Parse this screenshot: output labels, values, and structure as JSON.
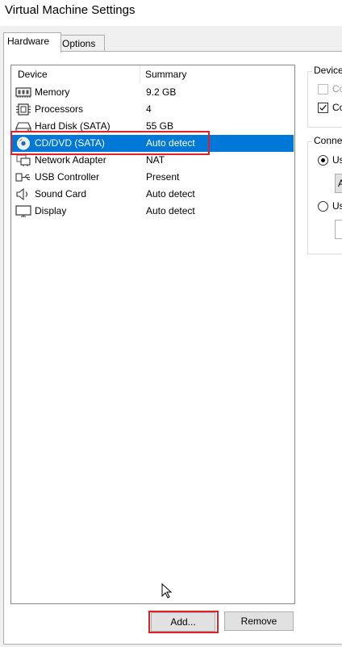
{
  "window": {
    "title": "Virtual Machine Settings"
  },
  "tabs": [
    {
      "label": "Hardware",
      "active": true
    },
    {
      "label": "Options",
      "active": false
    }
  ],
  "device_list": {
    "columns": [
      "Device",
      "Summary"
    ],
    "rows": [
      {
        "icon": "memory-icon",
        "device": "Memory",
        "summary": "9.2 GB"
      },
      {
        "icon": "processor-icon",
        "device": "Processors",
        "summary": "4"
      },
      {
        "icon": "hard-disk-icon",
        "device": "Hard Disk (SATA)",
        "summary": "55 GB"
      },
      {
        "icon": "cd-dvd-icon",
        "device": "CD/DVD (SATA)",
        "summary": "Auto detect",
        "selected": true
      },
      {
        "icon": "network-adapter-icon",
        "device": "Network Adapter",
        "summary": "NAT"
      },
      {
        "icon": "usb-icon",
        "device": "USB Controller",
        "summary": "Present"
      },
      {
        "icon": "sound-card-icon",
        "device": "Sound Card",
        "summary": "Auto detect"
      },
      {
        "icon": "display-icon",
        "device": "Display",
        "summary": "Auto detect"
      }
    ]
  },
  "right_panel": {
    "device_status": {
      "label": "Device",
      "connected_label": "Co",
      "connect_at_power_on_label": "Co",
      "connect_at_power_on_checked": true
    },
    "connection": {
      "label": "Conne",
      "use_physical_label": "Us",
      "use_physical_selected": true,
      "auto_value": "A",
      "use_iso_label": "Us"
    }
  },
  "buttons": {
    "add": "Add...",
    "remove": "Remove"
  },
  "colors": {
    "selection": "#0078d7",
    "highlight_box": "#e01f26"
  }
}
